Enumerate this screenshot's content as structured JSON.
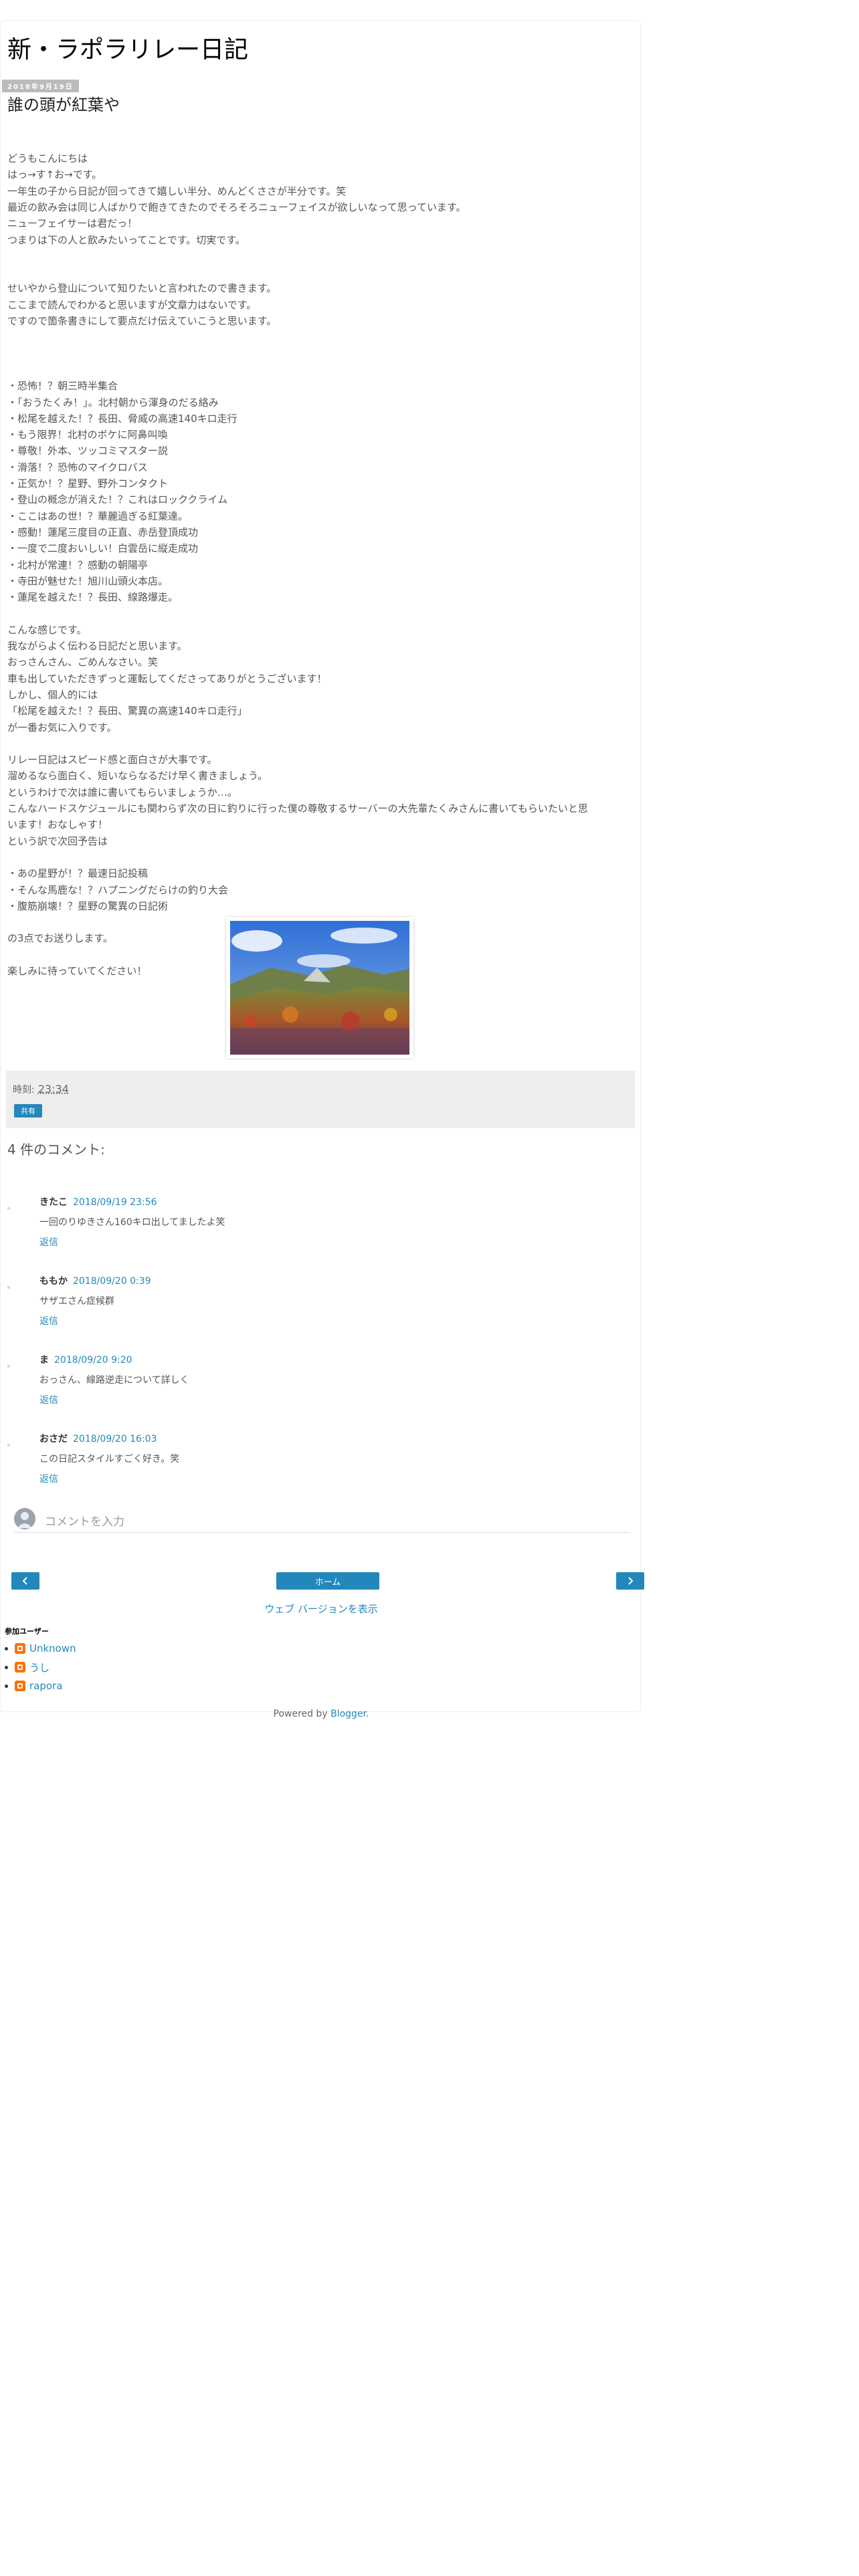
{
  "blog": {
    "title": "新・ラポラリレー日記"
  },
  "post": {
    "date": "2018年9月19日",
    "title": "誰の頭が紅葉や",
    "lines": [
      "どうもこんにちは",
      "はっ→す↑お→です。",
      "一年生の子から日記が回ってきて嬉しい半分、めんどくささが半分です。笑",
      "最近の飲み会は同じ人ばかりで飽きてきたのでそろそろニューフェイスが欲しいなって思っています。",
      "ニューフェイサーは君だっ！",
      "つまりは下の人と飲みたいってことです。切実です。",
      "",
      "",
      "せいやから登山について知りたいと言われたので書きます。",
      "ここまで読んでわかると思いますが文章力はないです。",
      "ですので箇条書きにして要点だけ伝えていこうと思います。",
      "",
      "",
      "",
      "・恐怖！？朝三時半集合",
      "・「おうたくみ！」。北村朝から渾身のだる絡み",
      "・松尾を越えた！？長田、脅威の高速140キロ走行",
      "・もう限界！北村のボケに阿鼻叫喚",
      "・尊敬！外本、ツッコミマスター説",
      "・滑落！？恐怖のマイクロバス",
      "・正気か！？星野、野外コンタクト",
      "・登山の概念が消えた！？これはロッククライム",
      "・ここはあの世！？華麗過ぎる紅葉達。",
      "・感動！蓮尾三度目の正直、赤岳登頂成功",
      "・一度で二度おいしい！白雲岳に縦走成功",
      "・北村が常連！？感動の朝陽亭",
      "・寺田が魅せた！旭川山頭火本店。",
      "・蓮尾を越えた！？長田、線路爆走。",
      "",
      "こんな感じです。",
      "我ながらよく伝わる日記だと思います。",
      "おっさんさん、ごめんなさい。笑",
      "車も出していただきずっと運転してくださってありがとうございます！",
      "しかし、個人的には",
      "「松尾を越えた！？長田、驚異の高速140キロ走行」",
      "が一番お気に入りです。",
      "",
      "リレー日記はスピード感と面白さが大事です。",
      "溜めるなら面白く、短いならなるだけ早く書きましょう。",
      "というわけで次は誰に書いてもらいましょうか…。",
      "こんなハードスケジュールにも関わらず次の日に釣りに行った僕の尊敬するサーバーの大先輩たくみさんに書いてもらいたいと思",
      "います！おなしゃす！",
      "という訳で次回予告は",
      "",
      "・あの星野が！？最速日記投稿",
      "・そんな馬鹿な！？ハプニングだらけの釣り大会",
      "・腹筋崩壊！？星野の驚異の日記術",
      "",
      "の3点でお送りします。",
      "",
      "楽しみに待っていてください！"
    ]
  },
  "post_footer": {
    "time_label": "時刻:",
    "time_value": "23:34",
    "share_label": "共有"
  },
  "comments": {
    "heading": "4 件のコメント:",
    "items": [
      {
        "author": "きたこ",
        "date": "2018/09/19 23:56",
        "body": "一回のりゆきさん160キロ出してましたよ笑",
        "reply": "返信"
      },
      {
        "author": "ももか",
        "date": "2018/09/20 0:39",
        "body": "サザエさん症候群",
        "reply": "返信"
      },
      {
        "author": "ま",
        "date": "2018/09/20 9:20",
        "body": "おっさん、線路逆走について詳しく",
        "reply": "返信"
      },
      {
        "author": "おさだ",
        "date": "2018/09/20 16:03",
        "body": "この日記スタイルすごく好き。笑",
        "reply": "返信"
      }
    ],
    "input_placeholder": "コメントを入力"
  },
  "nav": {
    "prev_icon": "chevron-left-icon",
    "home_label": "ホーム",
    "next_icon": "chevron-right-icon",
    "web_version": "ウェブ バージョンを表示"
  },
  "contributors": {
    "heading": "参加ユーザー",
    "items": [
      "Unknown",
      "うし",
      "rapora"
    ]
  },
  "powered": {
    "prefix": "Powered by ",
    "link": "Blogger",
    "suffix": "."
  },
  "colors": {
    "accent": "#2288bb",
    "footer_bg": "#eeeeee",
    "blogger_orange": "#ff6f00"
  }
}
